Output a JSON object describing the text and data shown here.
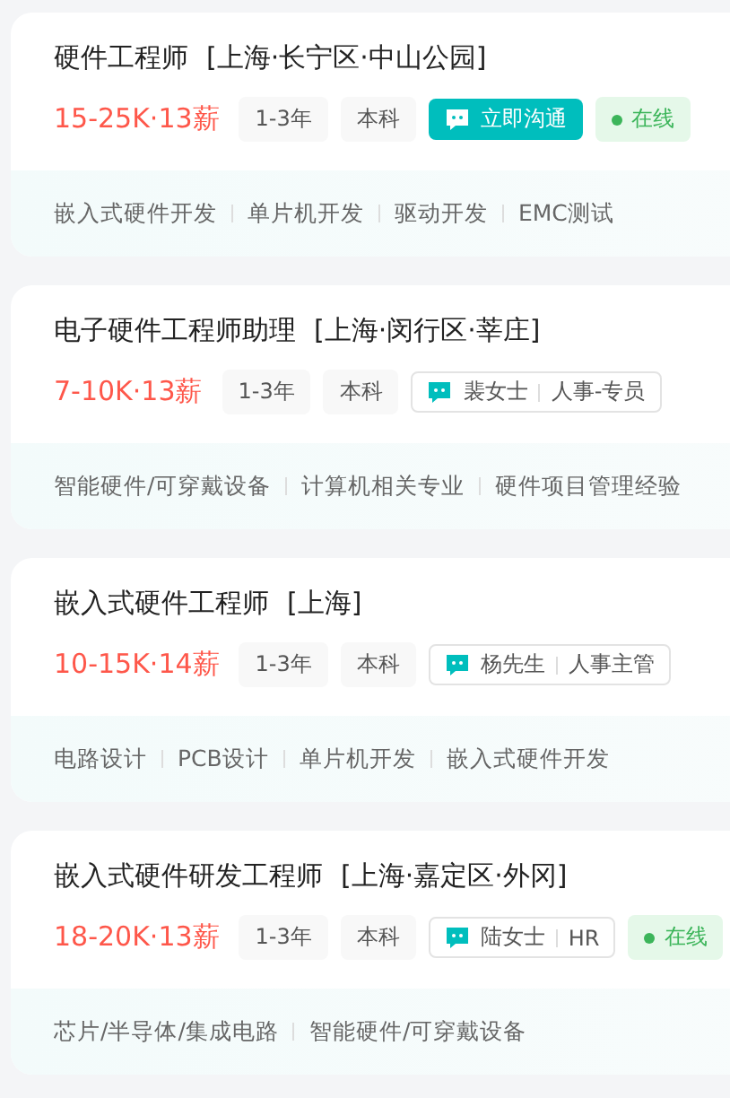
{
  "jobs": [
    {
      "title": "硬件工程师",
      "location": "[上海·长宁区·中山公园]",
      "salary": "15-25K·13薪",
      "tags": [
        "1-3年",
        "本科"
      ],
      "contact": {
        "kind": "chat",
        "label": "立即沟通"
      },
      "online": true,
      "online_label": "在线",
      "skills": [
        "嵌入式硬件开发",
        "单片机开发",
        "驱动开发",
        "EMC测试"
      ]
    },
    {
      "title": "电子硬件工程师助理",
      "location": "[上海·闵行区·莘庄]",
      "salary": "7-10K·13薪",
      "tags": [
        "1-3年",
        "本科"
      ],
      "contact": {
        "kind": "recruiter",
        "name": "裴女士",
        "role": "人事-专员"
      },
      "online": false,
      "skills": [
        "智能硬件/可穿戴设备",
        "计算机相关专业",
        "硬件项目管理经验"
      ]
    },
    {
      "title": "嵌入式硬件工程师",
      "location": "[上海]",
      "salary": "10-15K·14薪",
      "tags": [
        "1-3年",
        "本科"
      ],
      "contact": {
        "kind": "recruiter",
        "name": "杨先生",
        "role": "人事主管"
      },
      "online": false,
      "skills": [
        "电路设计",
        "PCB设计",
        "单片机开发",
        "嵌入式硬件开发"
      ]
    },
    {
      "title": "嵌入式硬件研发工程师",
      "location": "[上海·嘉定区·外冈]",
      "salary": "18-20K·13薪",
      "tags": [
        "1-3年",
        "本科"
      ],
      "contact": {
        "kind": "recruiter",
        "name": "陆女士",
        "role": "HR"
      },
      "online": true,
      "online_label": "在线",
      "skills": [
        "芯片/半导体/集成电路",
        "智能硬件/可穿戴设备"
      ]
    }
  ]
}
